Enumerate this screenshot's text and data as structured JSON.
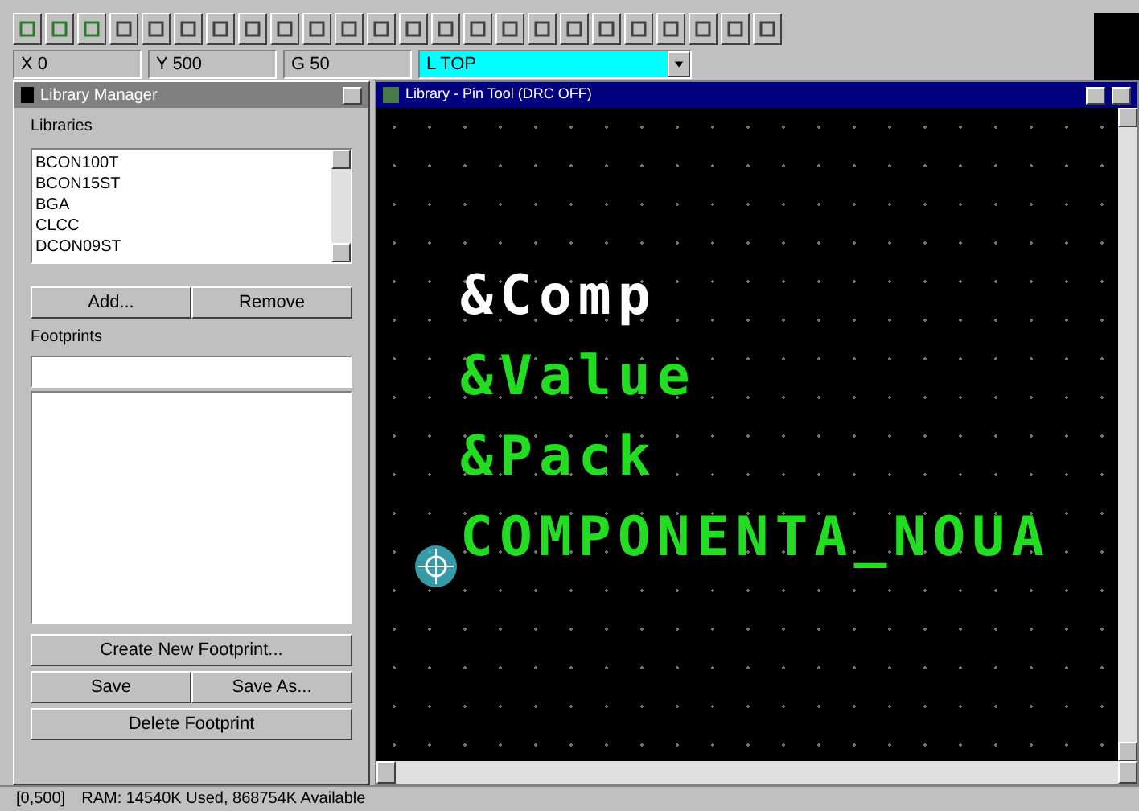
{
  "coordinates": {
    "x": "X 0",
    "y": "Y 500",
    "grid": "G 50",
    "layer": "L TOP"
  },
  "library_manager": {
    "title": "Library Manager",
    "libraries_label": "Libraries",
    "libraries": [
      "BCON100T",
      "BCON15ST",
      "BGA",
      "CLCC",
      "DCON09ST"
    ],
    "add_button": "Add...",
    "remove_button": "Remove",
    "footprints_label": "Footprints",
    "create_button": "Create New Footprint...",
    "save_button": "Save",
    "save_as_button": "Save As...",
    "delete_button": "Delete Footprint"
  },
  "canvas_window": {
    "title": "Library - Pin Tool (DRC OFF)",
    "texts": [
      {
        "text": "&Comp",
        "color": "#ffffff"
      },
      {
        "text": "&Value",
        "color": "#22dd22"
      },
      {
        "text": "&Pack",
        "color": "#22dd22"
      },
      {
        "text": "COMPONENTA_NOUA",
        "color": "#22dd22"
      }
    ]
  },
  "status_bar": {
    "position": "[0,500]",
    "memory": "RAM: 14540K Used, 868754K Available"
  }
}
